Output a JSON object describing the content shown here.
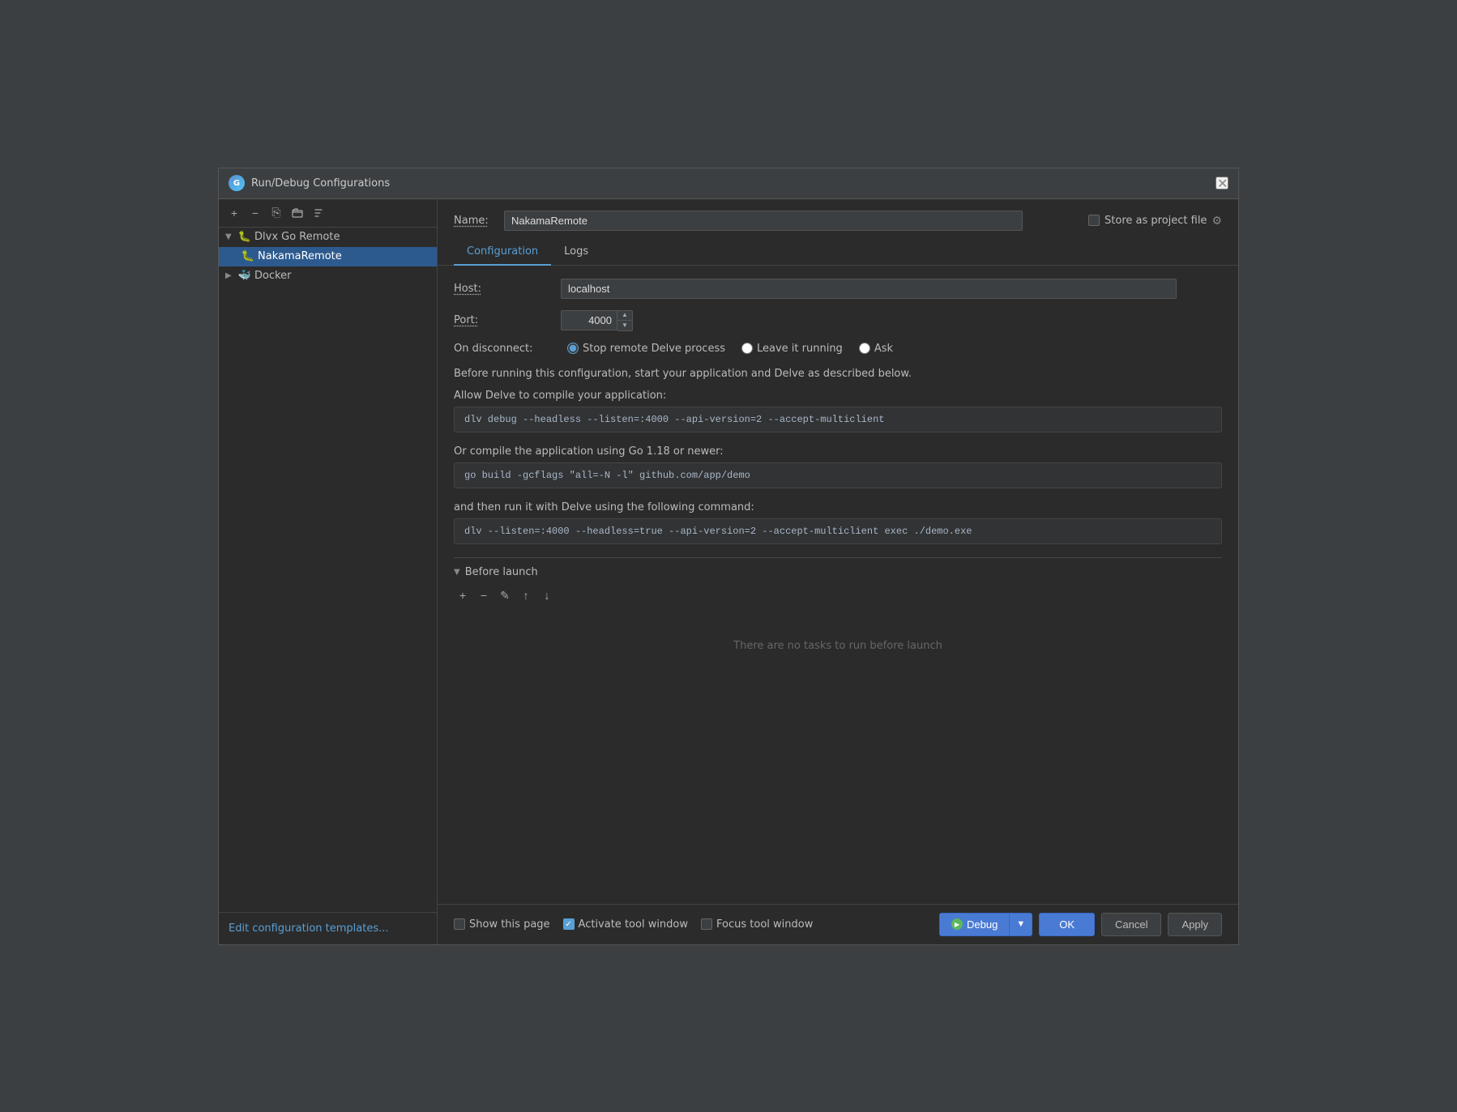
{
  "dialog": {
    "title": "Run/Debug Configurations",
    "close_icon": "✕"
  },
  "sidebar": {
    "toolbar": {
      "add_label": "+",
      "remove_label": "−",
      "copy_label": "⎘",
      "folder_label": "📁",
      "sort_label": "↕"
    },
    "tree": [
      {
        "id": "dlvx-go-remote",
        "label": "Dlvx Go Remote",
        "expanded": true,
        "level": "parent",
        "icon": "🐛",
        "children": [
          {
            "id": "nakama-remote",
            "label": "NakamaRemote",
            "selected": true,
            "icon": "🐛"
          }
        ]
      },
      {
        "id": "docker",
        "label": "Docker",
        "expanded": false,
        "level": "parent",
        "icon": "🐳"
      }
    ],
    "edit_templates_label": "Edit configuration templates..."
  },
  "main": {
    "name_label": "Name:",
    "name_value": "NakamaRemote",
    "store_as_project_label": "Store as project file",
    "tabs": [
      {
        "id": "configuration",
        "label": "Configuration",
        "active": true
      },
      {
        "id": "logs",
        "label": "Logs",
        "active": false
      }
    ],
    "host_label": "Host:",
    "host_value": "localhost",
    "port_label": "Port:",
    "port_value": "4000",
    "disconnect_label": "On disconnect:",
    "disconnect_options": [
      {
        "id": "stop-remote",
        "label": "Stop remote Delve process",
        "selected": true
      },
      {
        "id": "leave-running",
        "label": "Leave it running",
        "selected": false
      },
      {
        "id": "ask",
        "label": "Ask",
        "selected": false
      }
    ],
    "info_text": "Before running this configuration, start your application and Delve as described below.",
    "compile_section_title": "Allow Delve to compile your application:",
    "compile_command": "dlv debug --headless --listen=:4000 --api-version=2 --accept-multiclient",
    "go_compile_title": "Or compile the application using Go 1.18 or newer:",
    "go_compile_command": "go build -gcflags \"all=-N -l\" github.com/app/demo",
    "run_title": "and then run it with Delve using the following command:",
    "run_command": "dlv --listen=:4000 --headless=true --api-version=2 --accept-multiclient exec ./demo.exe",
    "before_launch": {
      "title": "Before launch",
      "empty_message": "There are no tasks to run before launch",
      "toolbar": {
        "add_label": "+",
        "remove_label": "−",
        "edit_label": "✎",
        "up_label": "↑",
        "down_label": "↓"
      }
    }
  },
  "bottom_bar": {
    "show_this_page_label": "Show this page",
    "show_this_page_checked": false,
    "activate_tool_window_label": "Activate tool window",
    "activate_tool_window_checked": true,
    "focus_tool_window_label": "Focus tool window",
    "focus_tool_window_checked": false
  },
  "buttons": {
    "debug_label": "Debug",
    "ok_label": "OK",
    "cancel_label": "Cancel",
    "apply_label": "Apply",
    "help_label": "?"
  }
}
